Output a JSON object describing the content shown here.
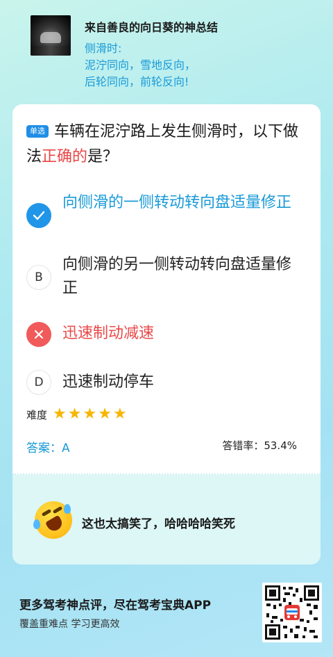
{
  "header": {
    "author": "来自善良的向日葵的神总结",
    "comment_lines": [
      "侧滑时:",
      "泥泞同向，雪地反向，",
      "后轮同向，前轮反向!"
    ]
  },
  "question": {
    "type_badge": "单选",
    "text_before": "车辆在泥泞路上发生侧滑时，以下做法",
    "text_highlight": "正确的",
    "text_after": "是？"
  },
  "options": [
    {
      "key": "A",
      "text": "向侧滑的一侧转动转向盘适量修正",
      "state": "correct",
      "icon": "check-icon"
    },
    {
      "key": "B",
      "text": "向侧滑的另一侧转动转向盘适量修正",
      "state": "normal",
      "icon": ""
    },
    {
      "key": "C",
      "text": "迅速制动减速",
      "state": "wrong",
      "icon": "cross-icon"
    },
    {
      "key": "D",
      "text": "迅速制动停车",
      "state": "normal",
      "icon": ""
    }
  ],
  "difficulty": {
    "label": "难度",
    "stars": 5,
    "max_stars": 5
  },
  "answer": {
    "text": "答案：A"
  },
  "error_rate": {
    "text": "答错率：53.4%"
  },
  "reaction": {
    "emoji": "rolling-laughing-emoji",
    "text": "这也太搞笑了，哈哈哈哈笑死"
  },
  "promo": {
    "title": "更多驾考神点评，尽在驾考宝典APP",
    "subtitle": "覆盖重难点 学习更高效"
  },
  "colors": {
    "accent_blue": "#1a9ad8",
    "correct_blue": "#2196e8",
    "wrong_red": "#f05a5a",
    "star": "#f7b500"
  }
}
